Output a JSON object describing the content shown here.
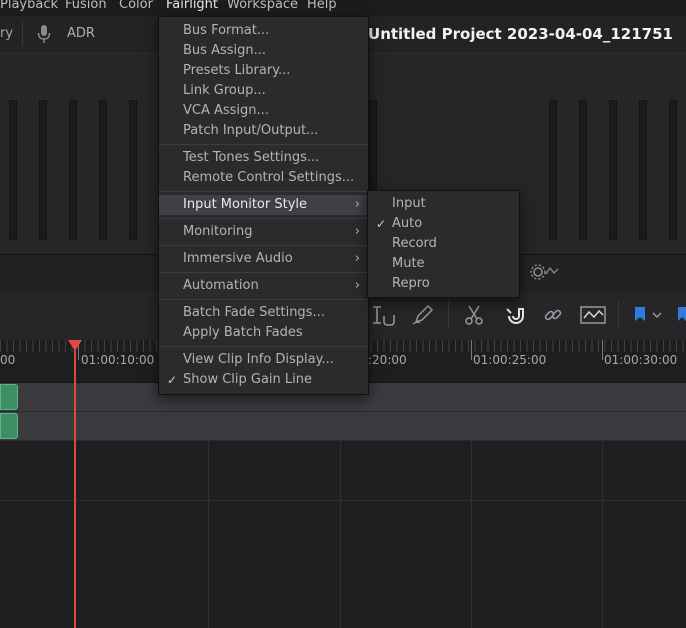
{
  "menubar": {
    "items": [
      "Playback",
      "Fusion",
      "Color",
      "Fairlight",
      "Workspace",
      "Help"
    ]
  },
  "toolbar": {
    "partial_left": "ry",
    "adr_label": "ADR",
    "project_title": "Untitled Project 2023-04-04_121751"
  },
  "ruler": {
    "timecodes": [
      "00",
      "01:00:10:00",
      ":20:00",
      "01:00:25:00",
      "01:00:30:00"
    ]
  },
  "fairlight_menu": {
    "items": [
      {
        "label": "Bus Format...",
        "check": "",
        "submenu": false,
        "highlight": false
      },
      {
        "label": "Bus Assign...",
        "check": "",
        "submenu": false,
        "highlight": false
      },
      {
        "label": "Presets Library...",
        "check": "",
        "submenu": false,
        "highlight": false
      },
      {
        "label": "Link Group...",
        "check": "",
        "submenu": false,
        "highlight": false
      },
      {
        "label": "VCA Assign...",
        "check": "",
        "submenu": false,
        "highlight": false
      },
      {
        "label": "Patch Input/Output...",
        "check": "",
        "submenu": false,
        "highlight": false
      },
      {
        "label": "Test Tones Settings...",
        "check": "",
        "submenu": false,
        "highlight": false
      },
      {
        "label": "Remote Control Settings...",
        "check": "",
        "submenu": false,
        "highlight": false
      },
      {
        "label": "Input Monitor Style",
        "check": "",
        "submenu": true,
        "highlight": true
      },
      {
        "label": "Monitoring",
        "check": "",
        "submenu": true,
        "highlight": false
      },
      {
        "label": "Immersive Audio",
        "check": "",
        "submenu": true,
        "highlight": false
      },
      {
        "label": "Automation",
        "check": "",
        "submenu": true,
        "highlight": false
      },
      {
        "label": "Batch Fade Settings...",
        "check": "",
        "submenu": false,
        "highlight": false
      },
      {
        "label": "Apply Batch Fades",
        "check": "",
        "submenu": false,
        "highlight": false
      },
      {
        "label": "View Clip Info Display...",
        "check": "",
        "submenu": false,
        "highlight": false
      },
      {
        "label": "Show Clip Gain Line",
        "check": "✓",
        "submenu": false,
        "highlight": false
      }
    ]
  },
  "input_monitor_submenu": {
    "items": [
      {
        "label": "Input",
        "check": ""
      },
      {
        "label": "Auto",
        "check": "✓"
      },
      {
        "label": "Record",
        "check": ""
      },
      {
        "label": "Mute",
        "check": ""
      },
      {
        "label": "Repro",
        "check": ""
      }
    ]
  },
  "colors": {
    "accent_blue": "#2f7be0",
    "playhead": "#e24b3e",
    "clip": "#3b8f62"
  }
}
